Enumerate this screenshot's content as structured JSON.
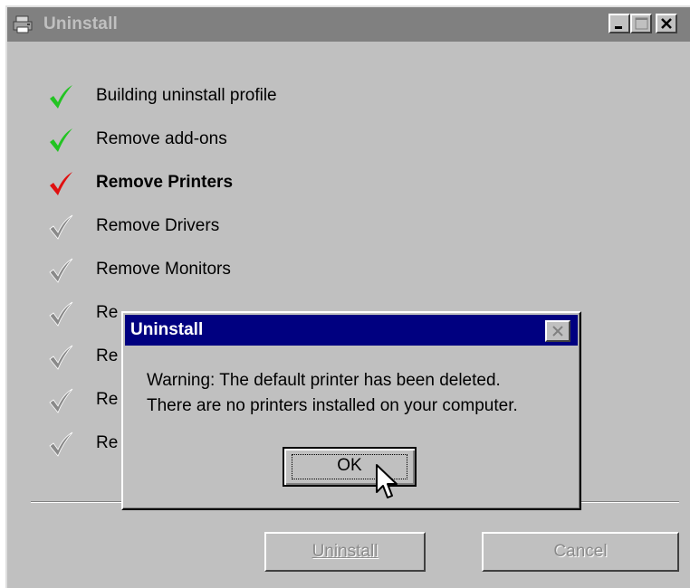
{
  "window": {
    "title": "Uninstall",
    "icon": "printer-icon"
  },
  "steps": [
    {
      "label": "Building uninstall profile",
      "state": "done",
      "check_color": "#22c422"
    },
    {
      "label": "Remove add-ons",
      "state": "done",
      "check_color": "#22c422"
    },
    {
      "label": "Remove Printers",
      "state": "current",
      "check_color": "#e01010"
    },
    {
      "label": "Remove Drivers",
      "state": "pending",
      "check_color": "#8a8a8a"
    },
    {
      "label": "Remove Monitors",
      "state": "pending",
      "check_color": "#8a8a8a"
    },
    {
      "label": "Re",
      "state": "pending",
      "check_color": "#8a8a8a"
    },
    {
      "label": "Re",
      "state": "pending",
      "check_color": "#8a8a8a"
    },
    {
      "label": "Re",
      "state": "pending",
      "check_color": "#8a8a8a"
    },
    {
      "label": "Re",
      "state": "pending",
      "check_color": "#8a8a8a"
    }
  ],
  "buttons": {
    "uninstall": "Uninstall",
    "cancel": "Cancel"
  },
  "dialog": {
    "title": "Uninstall",
    "message_line1": "Warning: The default printer has been deleted.",
    "message_line2": "There are no printers installed on your computer.",
    "ok_label": "OK"
  },
  "colors": {
    "done": "#22c422",
    "current": "#e01010",
    "pending": "#8a8a8a",
    "dialog_title_bg": "#000080",
    "window_title_bg": "#808080"
  }
}
